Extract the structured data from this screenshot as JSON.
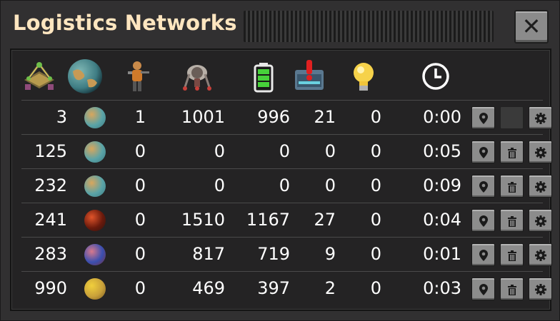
{
  "window": {
    "title": "Logistics Networks",
    "close_icon": "close-icon"
  },
  "columns": [
    "roboport-icon",
    "planet-icon",
    "engineer-icon",
    "robot-icon",
    "battery-icon",
    "chest-alert-icon",
    "lightbulb-icon",
    "clock-icon"
  ],
  "planets": {
    "nauvis": {
      "colors": [
        "#d9a65c",
        "#5aa3a7",
        "#3d7c82"
      ]
    },
    "vulcanus": {
      "colors": [
        "#e0542a",
        "#6b1a0c",
        "#2b1310"
      ]
    },
    "gleba": {
      "colors": [
        "#d8798c",
        "#3a4fb0",
        "#7a2f3a"
      ]
    },
    "fulgora": {
      "colors": [
        "#f0cf3c",
        "#c9a13a",
        "#7b5a22"
      ]
    }
  },
  "rows": [
    {
      "id": "3",
      "planet": "nauvis",
      "characters": "1",
      "robots": "1001",
      "charging": "996",
      "requests": "21",
      "lights": "0",
      "time": "0:00",
      "delete_disabled": true
    },
    {
      "id": "125",
      "planet": "nauvis",
      "characters": "0",
      "robots": "0",
      "charging": "0",
      "requests": "0",
      "lights": "0",
      "time": "0:05",
      "delete_disabled": false
    },
    {
      "id": "232",
      "planet": "nauvis",
      "characters": "0",
      "robots": "0",
      "charging": "0",
      "requests": "0",
      "lights": "0",
      "time": "0:09",
      "delete_disabled": false
    },
    {
      "id": "241",
      "planet": "vulcanus",
      "characters": "0",
      "robots": "1510",
      "charging": "1167",
      "requests": "27",
      "lights": "0",
      "time": "0:04",
      "delete_disabled": false
    },
    {
      "id": "283",
      "planet": "gleba",
      "characters": "0",
      "robots": "817",
      "charging": "719",
      "requests": "9",
      "lights": "0",
      "time": "0:01",
      "delete_disabled": false
    },
    {
      "id": "990",
      "planet": "fulgora",
      "characters": "0",
      "robots": "469",
      "charging": "397",
      "requests": "2",
      "lights": "0",
      "time": "0:03",
      "delete_disabled": false
    }
  ],
  "row_buttons": [
    "map-pin-icon",
    "trash-icon",
    "gear-icon"
  ]
}
